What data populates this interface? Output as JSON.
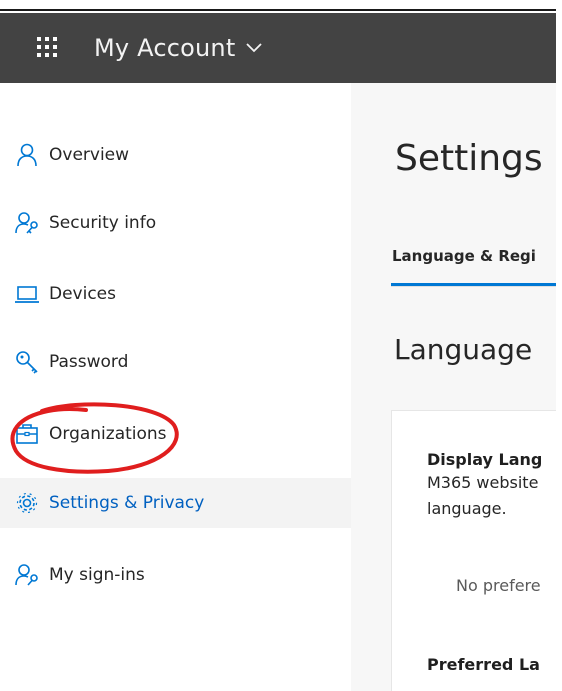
{
  "header": {
    "app_title": "My Account",
    "background": "#434343",
    "waffle_icon": "app-launcher-icon",
    "chevron_icon": "chevron-down-icon"
  },
  "sidebar": {
    "items": [
      {
        "label": "Overview",
        "icon": "person-icon",
        "selected": false
      },
      {
        "label": "Security info",
        "icon": "person-key-icon",
        "selected": false
      },
      {
        "label": "Devices",
        "icon": "laptop-icon",
        "selected": false
      },
      {
        "label": "Password",
        "icon": "key-icon",
        "selected": false,
        "annotated": true
      },
      {
        "label": "Organizations",
        "icon": "briefcase-icon",
        "selected": false
      },
      {
        "label": "Settings & Privacy",
        "icon": "gear-icon",
        "selected": true
      },
      {
        "label": "My sign-ins",
        "icon": "person-key-icon",
        "selected": false
      }
    ],
    "annotation_color": "#e01e1e"
  },
  "main": {
    "title": "Settings",
    "tab_label": "Language & Regi",
    "section_title": "Language",
    "card": {
      "display_label": "Display Lang",
      "display_desc_1": "M365 website",
      "display_desc_2": "language.",
      "display_value": "No prefere",
      "preferred_label": "Preferred La"
    },
    "accent": "#0078d4",
    "selected_color": "#0060c0"
  }
}
